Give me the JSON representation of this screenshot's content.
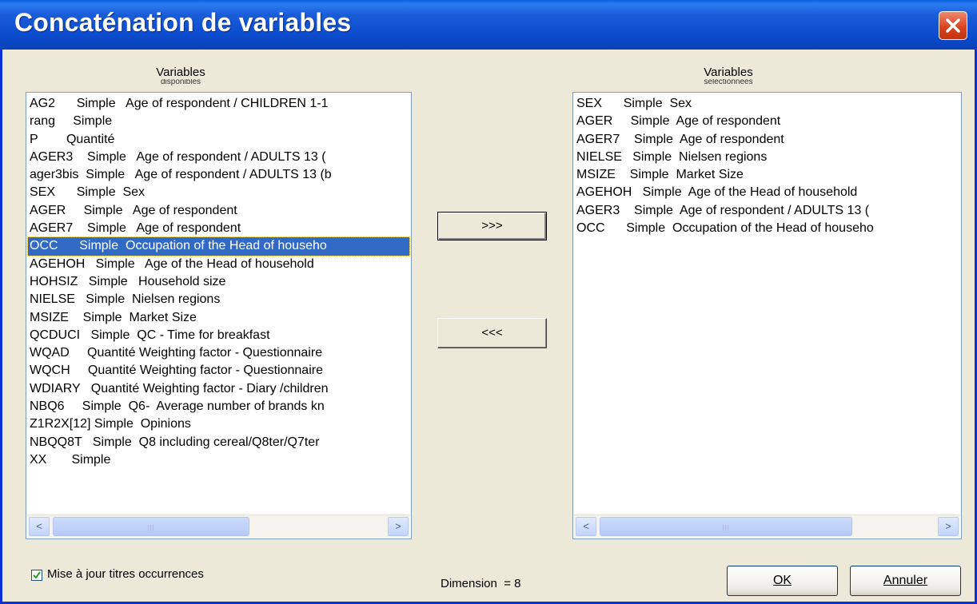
{
  "window": {
    "title": "Concaténation de variables",
    "close_label": "close"
  },
  "left": {
    "caption": "Variables",
    "caption_sub": "disponibles",
    "items": [
      "AG2      Simple   Age of respondent / CHILDREN 1-1",
      "rang     Simple",
      "P        Quantité",
      "AGER3    Simple   Age of respondent / ADULTS 13 (",
      "ager3bis  Simple   Age of respondent / ADULTS 13 (b",
      "SEX      Simple  Sex",
      "AGER     Simple   Age of respondent",
      "AGER7    Simple   Age of respondent",
      "OCC      Simple  Occupation of the Head of househo",
      "AGEHOH   Simple   Age of the Head of household",
      "HOHSIZ   Simple   Household size",
      "NIELSE   Simple  Nielsen regions",
      "MSIZE    Simple  Market Size",
      "QCDUCI   Simple  QC - Time for breakfast",
      "WQAD     Quantité Weighting factor - Questionnaire",
      "WQCH     Quantité Weighting factor - Questionnaire",
      "WDIARY   Quantité Weighting factor - Diary /children",
      "NBQ6     Simple  Q6-  Average number of brands kn",
      "Z1R2X[12] Simple  Opinions",
      "NBQQ8T   Simple  Q8 including cereal/Q8ter/Q7ter",
      "XX       Simple"
    ],
    "selected_index": 8
  },
  "right": {
    "caption": "Variables",
    "caption_sub": "sélectionnées",
    "items": [
      "SEX      Simple  Sex",
      "AGER     Simple  Age of respondent",
      "AGER7    Simple  Age of respondent",
      "NIELSE   Simple  Nielsen regions",
      "MSIZE    Simple  Market Size",
      "AGEHOH   Simple  Age of the Head of household",
      "AGER3    Simple  Age of respondent / ADULTS 13 (",
      "OCC      Simple  Occupation of the Head of househo"
    ]
  },
  "buttons": {
    "add": ">>>",
    "remove": "<<<",
    "ok": "OK",
    "cancel": "Annuler"
  },
  "checkbox": {
    "label": "Mise à jour titres occurrences",
    "checked": true
  },
  "dimension": "Dimension  = 8",
  "colors": {
    "titlebar": "#0a4fd0",
    "selection": "#316ac5",
    "close": "#d8401c"
  }
}
